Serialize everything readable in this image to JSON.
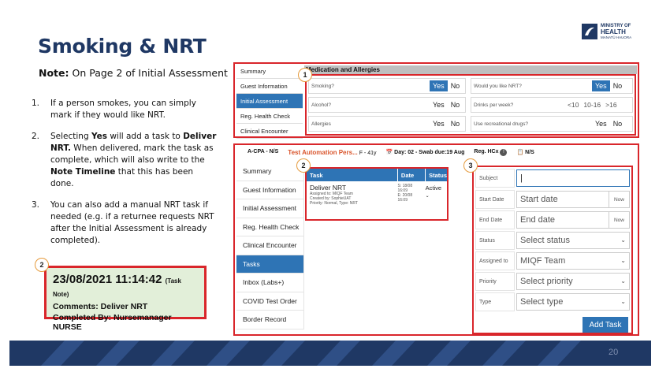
{
  "slide": {
    "title": "Smoking & NRT",
    "note_bold": "Note:",
    "note_text": " On Page 2 of Initial Assessment",
    "page_number": "20",
    "logo": {
      "line1": "MINISTRY OF",
      "line2": "HEALTH",
      "line3": "MANATŪ HAUORA"
    }
  },
  "instructions": [
    {
      "num": "1.",
      "parts": [
        {
          "t": "If a person smokes, you can simply mark if they would like NRT.",
          "b": false
        }
      ]
    },
    {
      "num": "2.",
      "parts": [
        {
          "t": "Selecting ",
          "b": false
        },
        {
          "t": "Yes",
          "b": true
        },
        {
          "t": " will add a task to ",
          "b": false
        },
        {
          "t": "Deliver NRT.",
          "b": true
        },
        {
          "t": " When delivered, mark the task as complete, which will also write to the ",
          "b": false
        },
        {
          "t": "Note Timeline",
          "b": true
        },
        {
          "t": " that this has been done.",
          "b": false
        }
      ]
    },
    {
      "num": "3.",
      "parts": [
        {
          "t": "You can also add a manual NRT task if needed (e.g. if a returnee requests NRT after the Initial Assessment is already completed).",
          "b": false
        }
      ]
    }
  ],
  "task_note": {
    "badge": "2",
    "datetime": "23/08/2021 11:14:42",
    "tag": "(Task Note)",
    "comments": "Comments: Deliver NRT",
    "completed_by": "Completed By: Nursemanager NURSE"
  },
  "top_panel": {
    "badge": "1",
    "nav": [
      "Summary",
      "Guest Information",
      "Initial Assessment",
      "Reg. Health Check",
      "Clinical Encounter"
    ],
    "active_nav": 2,
    "section_title": "Medication and Allergies",
    "rows": [
      {
        "left_label": "Smoking?",
        "left_yes": "Yes",
        "left_no": "No",
        "left_sel": "yes",
        "right_label": "Would you like NRT?",
        "right_type": "yn",
        "right_yes": "Yes",
        "right_no": "No",
        "right_sel": "yes"
      },
      {
        "left_label": "Alcohol?",
        "left_yes": "Yes",
        "left_no": "No",
        "left_sel": "",
        "right_label": "Drinks per week?",
        "right_type": "opts",
        "right_opts": [
          "<10",
          "10-16",
          ">16"
        ]
      },
      {
        "left_label": "Allergies",
        "left_yes": "Yes",
        "left_no": "No",
        "left_sel": "",
        "right_label": "Use recreational drugs?",
        "right_type": "yn",
        "right_yes": "Yes",
        "right_no": "No",
        "right_sel": ""
      }
    ]
  },
  "bottom_panel": {
    "header": {
      "id": "A-CPA - N/S",
      "patient": "Test Automation Pers...",
      "patient_info": "F - 41y",
      "day": "Day: 02 - Swab due:19 Aug",
      "reg": "Reg. HCx",
      "ns": "N/S"
    },
    "nav": [
      "Summary",
      "Guest Information",
      "Initial Assessment",
      "Reg. Health Check",
      "Clinical Encounter",
      "Tasks",
      "Inbox (Labs+)",
      "COVID Test Order",
      "Border Record"
    ],
    "active_nav": 5,
    "tasks_badge": "2",
    "tasks_table": {
      "headers": [
        "Task",
        "Date",
        "Status"
      ],
      "row": {
        "name": "Deliver NRT",
        "assigned": "Assigned to: MIQF Team",
        "created": "Created by: SophieUAT",
        "priority": "Priority: Normal, Type: NRT",
        "date_s": "S: 18/08",
        "time_s": "16:09",
        "date_e": "E: 20/08",
        "time_e": "16:09",
        "status": "Active"
      }
    },
    "form_badge": "3",
    "form": {
      "subject_label": "Subject",
      "subject_value": "|",
      "start_label": "Start Date",
      "start_placeholder": "Start date",
      "start_now": "Now",
      "end_label": "End Date",
      "end_placeholder": "End date",
      "end_now": "Now",
      "status_label": "Status",
      "status_value": "Select status",
      "assigned_label": "Assigned to",
      "assigned_value": "MIQF Team",
      "priority_label": "Priority",
      "priority_value": "Select priority",
      "type_label": "Type",
      "type_value": "Select type",
      "add_label": "Add Task"
    }
  }
}
